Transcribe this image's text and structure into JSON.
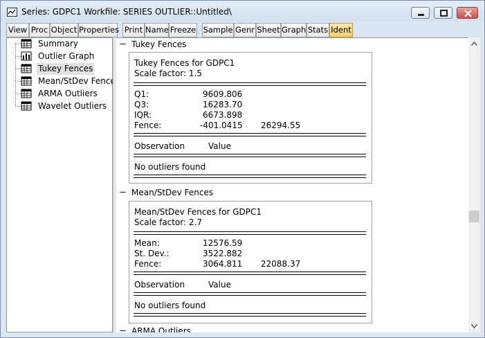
{
  "window": {
    "title": "Series: GDPC1   Workfile: SERIES OUTLIER::Untitled\\"
  },
  "toolbar": {
    "buttons": [
      "View",
      "Proc",
      "Object",
      "Properties",
      "Print",
      "Name",
      "Freeze",
      "Sample",
      "Genr",
      "Sheet",
      "Graph",
      "Stats",
      "Ident"
    ],
    "active": "Ident"
  },
  "tree": {
    "items": [
      {
        "label": "Summary",
        "icon": "table-icon"
      },
      {
        "label": "Outlier Graph",
        "icon": "bar-chart-icon"
      },
      {
        "label": "Tukey Fences",
        "icon": "table-icon"
      },
      {
        "label": "Mean/StDev Fences",
        "icon": "table-icon"
      },
      {
        "label": "ARMA Outliers",
        "icon": "table-icon"
      },
      {
        "label": "Wavelet Outliers",
        "icon": "table-icon"
      }
    ],
    "selected": "Tukey Fences"
  },
  "sections": [
    {
      "heading": "Tukey Fences",
      "title": "Tukey Fences for GDPC1",
      "scale": "Scale factor: 1.5",
      "stats": [
        {
          "label": "Q1:",
          "v1": "9609.806",
          "v2": ""
        },
        {
          "label": "Q3:",
          "v1": "16283.70",
          "v2": ""
        },
        {
          "label": "IQR:",
          "v1": "6673.898",
          "v2": ""
        },
        {
          "label": "Fence:",
          "v1": "-401.0415",
          "v2": "26294.55"
        }
      ],
      "col_observation": "Observation",
      "col_value": "Value",
      "result": "No outliers found"
    },
    {
      "heading": "Mean/StDev Fences",
      "title": "Mean/StDev Fences for GDPC1",
      "scale": "Scale factor: 2.7",
      "stats": [
        {
          "label": "Mean:",
          "v1": "12576.59",
          "v2": ""
        },
        {
          "label": "St. Dev.:",
          "v1": "3522.882",
          "v2": ""
        },
        {
          "label": "Fence:",
          "v1": "3064.811",
          "v2": "22088.37"
        }
      ],
      "col_observation": "Observation",
      "col_value": "Value",
      "result": "No outliers found"
    },
    {
      "heading": "ARMA Outliers"
    }
  ]
}
